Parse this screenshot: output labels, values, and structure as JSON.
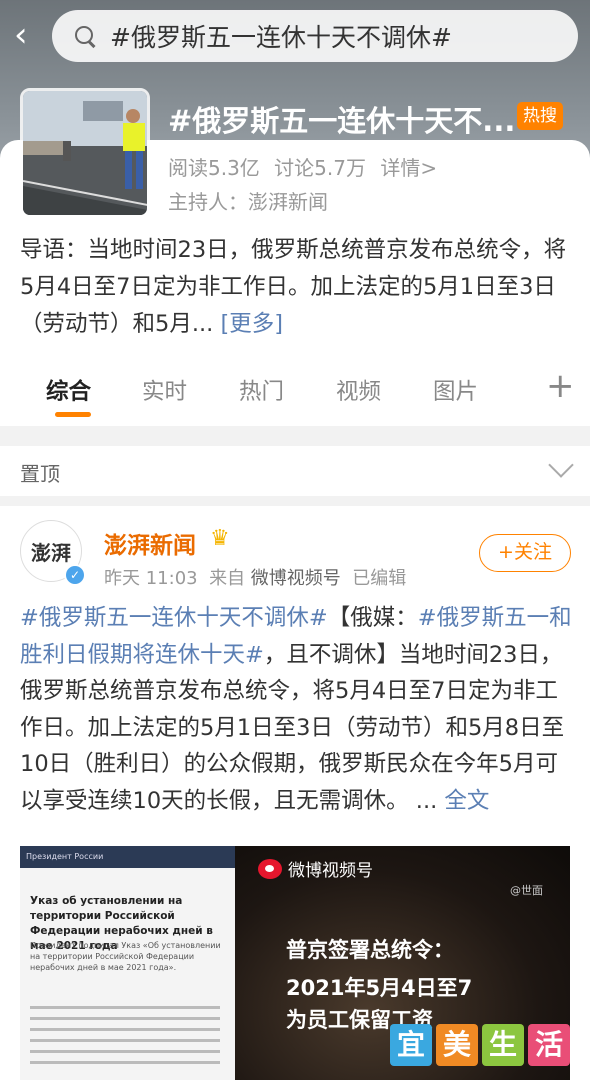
{
  "search": {
    "query": "#俄罗斯五一连休十天不调休#"
  },
  "topic": {
    "title": "#俄罗斯五一连休十天不...",
    "hot_badge": "热搜",
    "reads": "阅读5.3亿",
    "discussions": "讨论5.7万",
    "details": "详情>",
    "host": "主持人：澎湃新闻",
    "lead": "导语：当地时间23日，俄罗斯总统普京发布总统令，将5月4日至7日定为非工作日。加上法定的5月1日至3日（劳动节）和5月...",
    "more": "[更多]"
  },
  "tabs": [
    {
      "label": "综合"
    },
    {
      "label": "实时"
    },
    {
      "label": "热门"
    },
    {
      "label": "视频"
    },
    {
      "label": "图片"
    }
  ],
  "pinned": {
    "label": "置顶"
  },
  "post": {
    "author": "澎湃新闻",
    "avatar_text": "澎湃",
    "time": "昨天 11:03",
    "source_prefix": "来自",
    "source": "微博视频号",
    "edited": "已编辑",
    "follow": "+关注",
    "tag1": "#俄罗斯五一连休十天不调休#",
    "text1": "【俄媒：",
    "tag2": "#俄罗斯五一和胜利日假期将连休十天#",
    "text2": "，且不调休】当地时间23日，俄罗斯总统普京发布总统令，将5月4日至7日定为非工作日。加上法定的5月1日至3日（劳动节）和5月8日至10日（胜利日）的公众假期，俄罗斯民众在今年5月可以享受连续10天的长假，且无需调休。",
    "ellipsis": " ... ",
    "fulltext": "全文"
  },
  "media": {
    "doc_header": "Президент России",
    "doc_title": "Указ об установлении на территории Российской Федерации нерабочих дней в мае 2021 года",
    "doc_body": "Президент подписал Указ «Об установлении на территории Российской Федерации нерабочих дней в мае 2021 года».",
    "weibo_label": "微博视频号",
    "weibo_sub": "@世面",
    "caption1": "普京签署总统令：",
    "caption2": "2021年5月4日至7",
    "caption3": "为员工保留工资"
  },
  "watermark": [
    "宜",
    "美",
    "生",
    "活"
  ],
  "colors": {
    "accent": "#ff8200",
    "link": "#5b7fb4",
    "author": "#ea6b00"
  }
}
